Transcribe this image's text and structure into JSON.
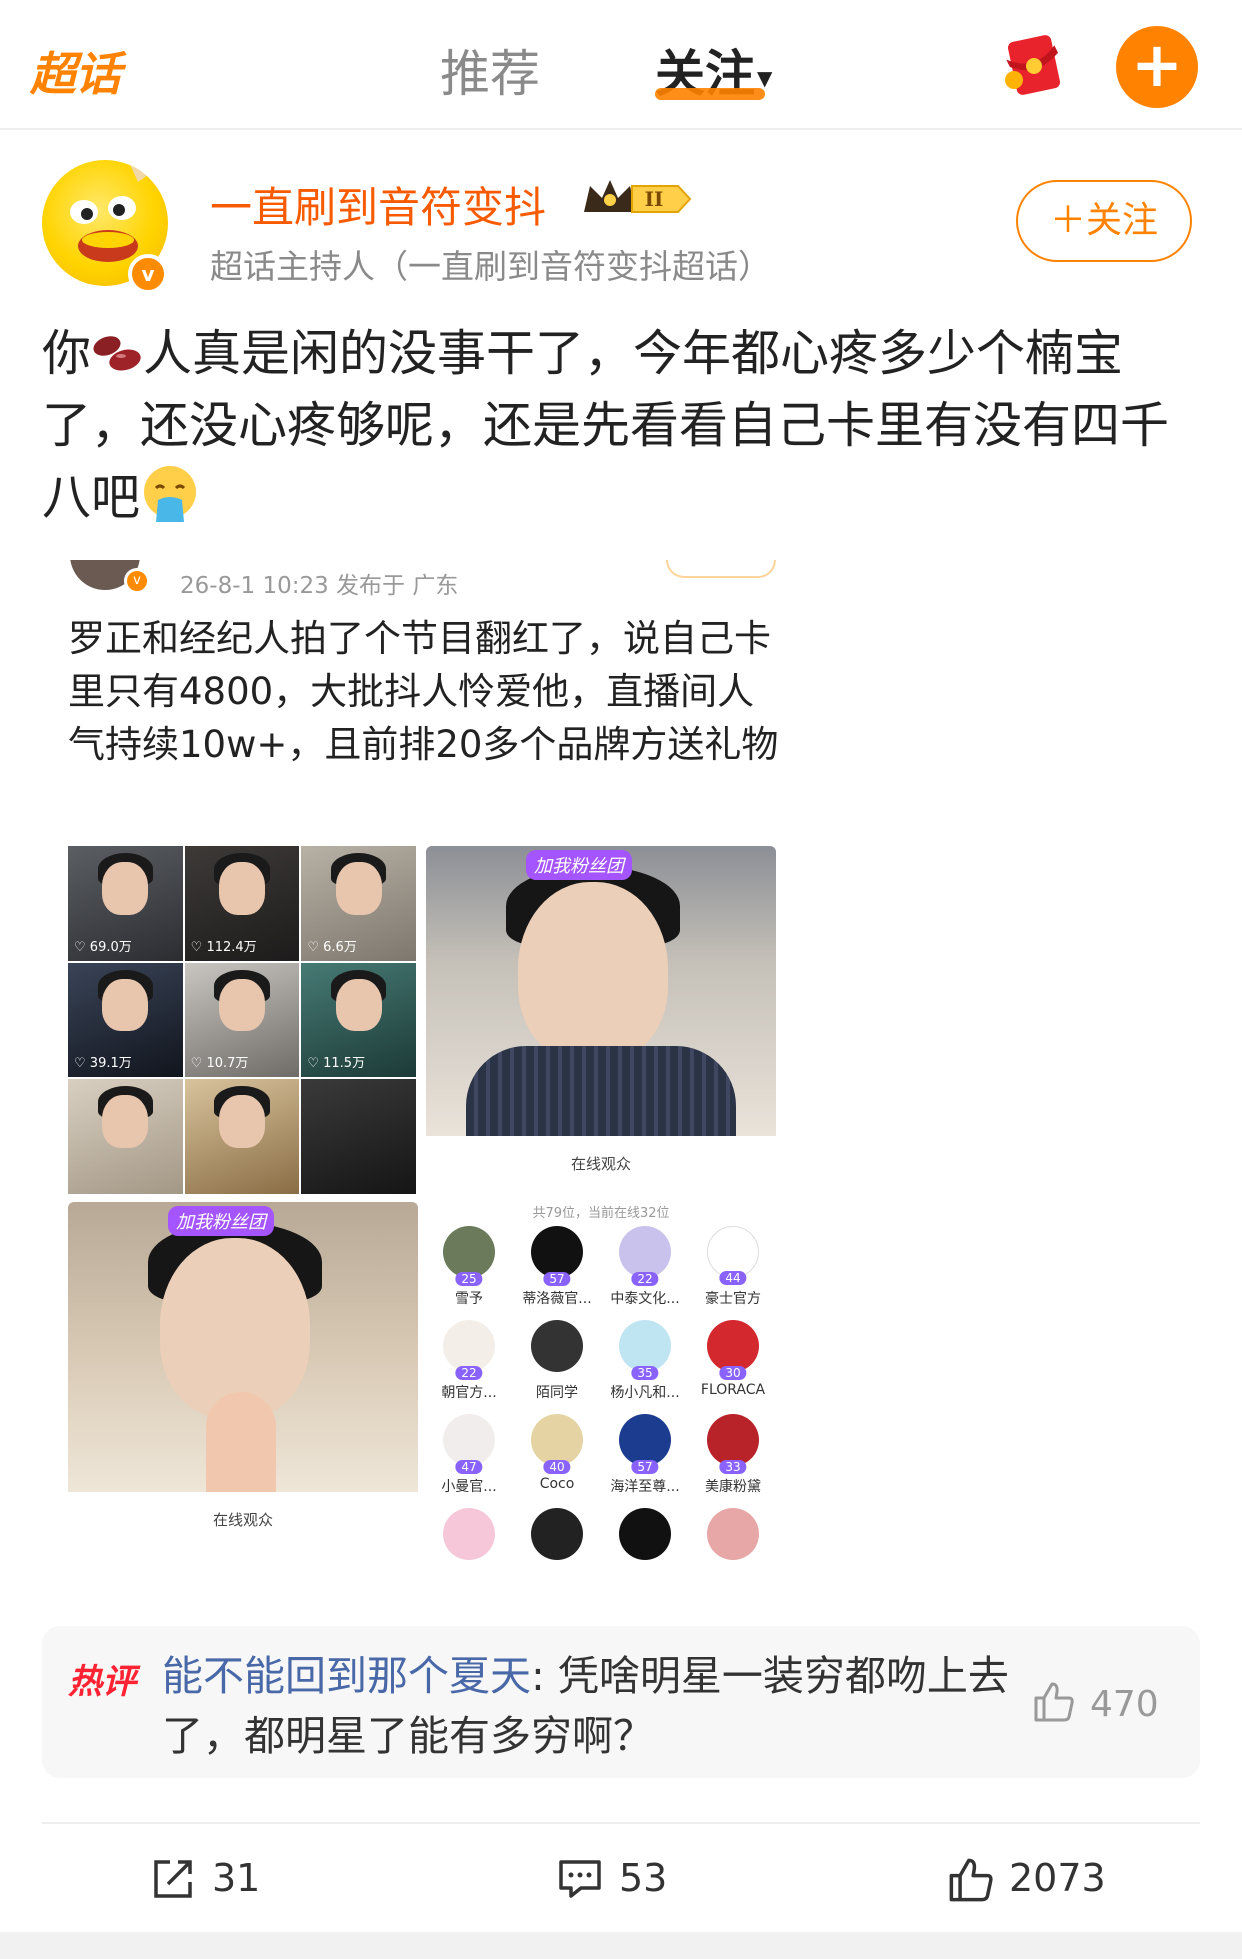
{
  "header": {
    "logo": "超话",
    "tabs": [
      {
        "label": "推荐",
        "active": false
      },
      {
        "label": "关注",
        "active": true
      }
    ],
    "accent_color": "#ff8200",
    "icons": [
      "red-packet-icon",
      "plus-icon"
    ]
  },
  "post": {
    "author": {
      "name": "一直刷到音符变抖",
      "role": "超话主持人（一直刷到音符变抖超话）",
      "follow_label": "＋关注",
      "verified": true
    },
    "text_before_emoji": "你",
    "text_after_emoji": "人真是闲的没事干了，今年都心疼多少个楠宝了，还没心疼够呢，还是先看看自己卡里有没有四千八吧",
    "embedded": {
      "meta": "26-8-1 10:23  发布于 广东",
      "text": "罗正和经纪人拍了个节目翻红了，说自己卡里只有4800，大批抖人怜爱他，直播间人气持续10w+，且前排20多个品牌方送礼物",
      "grid_likes": [
        "69.0万",
        "112.4万",
        "6.6万",
        "39.1万",
        "10.7万",
        "11.5万"
      ],
      "live_tag": "加我粉丝团",
      "live_footer": "在线观众",
      "fans_header": "共79位，当前在线32位",
      "fans": [
        {
          "name": "雪予",
          "level": "25"
        },
        {
          "name": "蒂洛薇官...",
          "level": "57"
        },
        {
          "name": "中泰文化...",
          "level": "22"
        },
        {
          "name": "豪士官方",
          "level": "44"
        },
        {
          "name": "朝官方...",
          "level": "22"
        },
        {
          "name": "陌同学",
          "level": ""
        },
        {
          "name": "杨小凡和...",
          "level": "35"
        },
        {
          "name": "FLORACA",
          "level": "30"
        },
        {
          "name": "小曼官...",
          "level": "47"
        },
        {
          "name": "Coco",
          "level": "40"
        },
        {
          "name": "海洋至尊...",
          "level": "57"
        },
        {
          "name": "美康粉黛",
          "level": "33"
        }
      ]
    },
    "hot_comment": {
      "tag": "热评",
      "user": "能不能回到那个夏天",
      "text": ": 凭啥明星一装穷都吻上去了，都明星了能有多穷啊？",
      "likes": "470"
    },
    "actions": {
      "shares": "31",
      "comments": "53",
      "likes": "2073"
    }
  }
}
